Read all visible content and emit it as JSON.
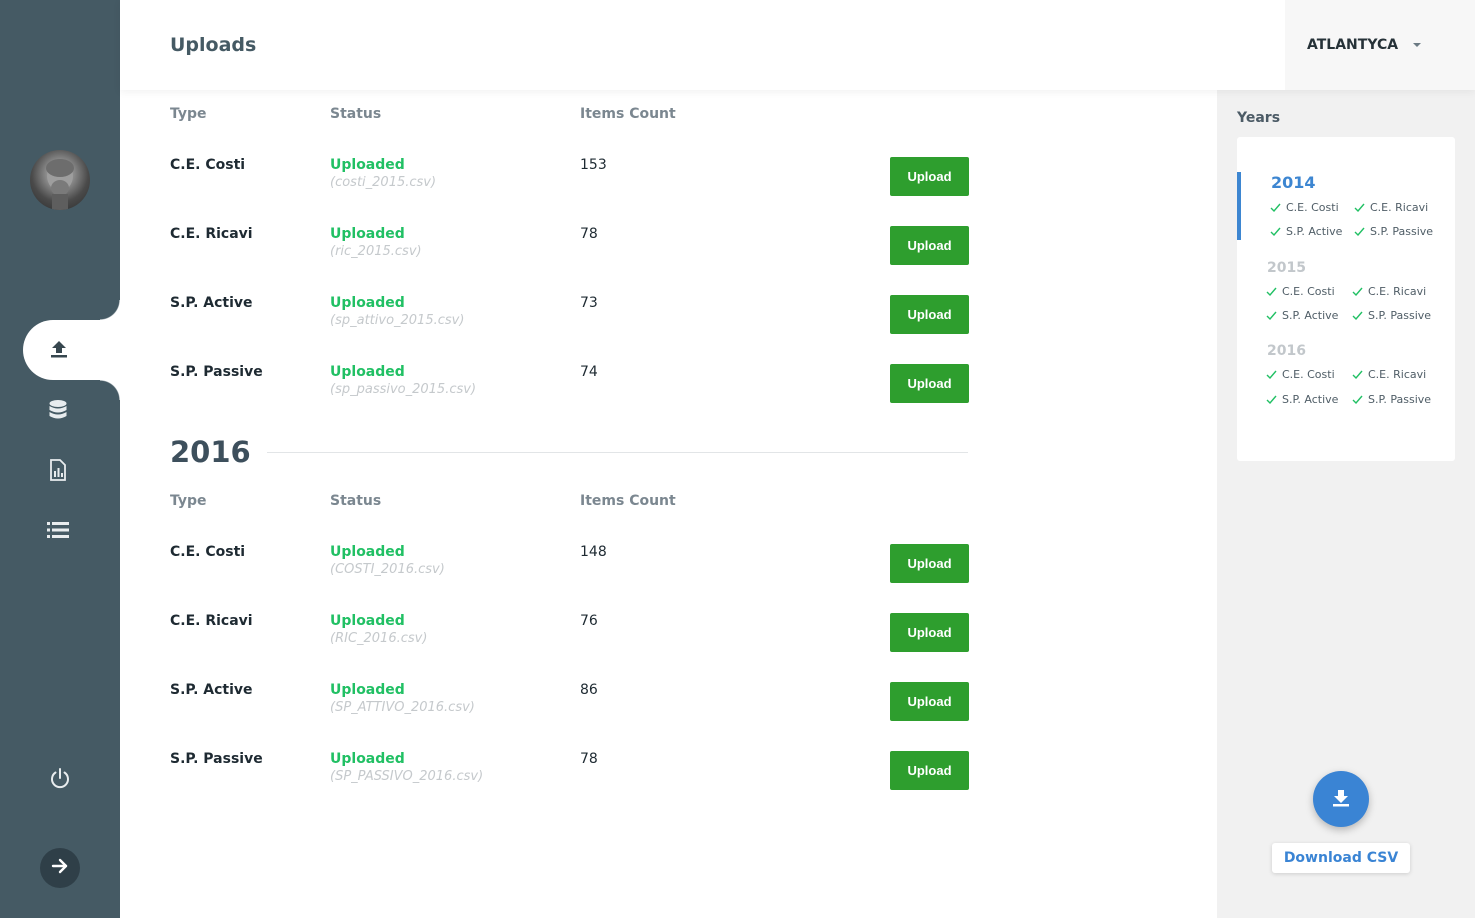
{
  "header": {
    "title": "Uploads",
    "company": "ATLANTYCA"
  },
  "table": {
    "col_type": "Type",
    "col_status": "Status",
    "col_count": "Items Count",
    "upload_label": "Upload"
  },
  "section_2015": {
    "rows": [
      {
        "type": "C.E. Costi",
        "status": "Uploaded",
        "file": "(costi_2015.csv)",
        "count": "153"
      },
      {
        "type": "C.E. Ricavi",
        "status": "Uploaded",
        "file": "(ric_2015.csv)",
        "count": "78"
      },
      {
        "type": "S.P. Active",
        "status": "Uploaded",
        "file": "(sp_attivo_2015.csv)",
        "count": "73"
      },
      {
        "type": "S.P. Passive",
        "status": "Uploaded",
        "file": "(sp_passivo_2015.csv)",
        "count": "74"
      }
    ]
  },
  "section_2016": {
    "year": "2016",
    "rows": [
      {
        "type": "C.E. Costi",
        "status": "Uploaded",
        "file": "(COSTI_2016.csv)",
        "count": "148"
      },
      {
        "type": "C.E. Ricavi",
        "status": "Uploaded",
        "file": "(RIC_2016.csv)",
        "count": "76"
      },
      {
        "type": "S.P. Active",
        "status": "Uploaded",
        "file": "(SP_ATTIVO_2016.csv)",
        "count": "86"
      },
      {
        "type": "S.P. Passive",
        "status": "Uploaded",
        "file": "(SP_PASSIVO_2016.csv)",
        "count": "78"
      }
    ]
  },
  "years_panel": {
    "label": "Years",
    "years": [
      {
        "year": "2014",
        "items": [
          "C.E. Costi",
          "C.E. Ricavi",
          "S.P. Active",
          "S.P. Passive"
        ]
      },
      {
        "year": "2015",
        "items": [
          "C.E. Costi",
          "C.E. Ricavi",
          "S.P. Active",
          "S.P. Passive"
        ]
      },
      {
        "year": "2016",
        "items": [
          "C.E. Costi",
          "C.E. Ricavi",
          "S.P. Active",
          "S.P. Passive"
        ]
      }
    ]
  },
  "download": {
    "label": "Download CSV"
  },
  "icons": {
    "nav": [
      "upload-icon",
      "database-icon",
      "report-icon",
      "list-icon"
    ],
    "power": "power-icon",
    "expand": "arrow-right-icon",
    "download": "download-icon"
  },
  "colors": {
    "sidebar": "#455a64",
    "uploaded": "#21c064",
    "upload_button": "#2e9e2e",
    "accent": "#3a84d4"
  }
}
